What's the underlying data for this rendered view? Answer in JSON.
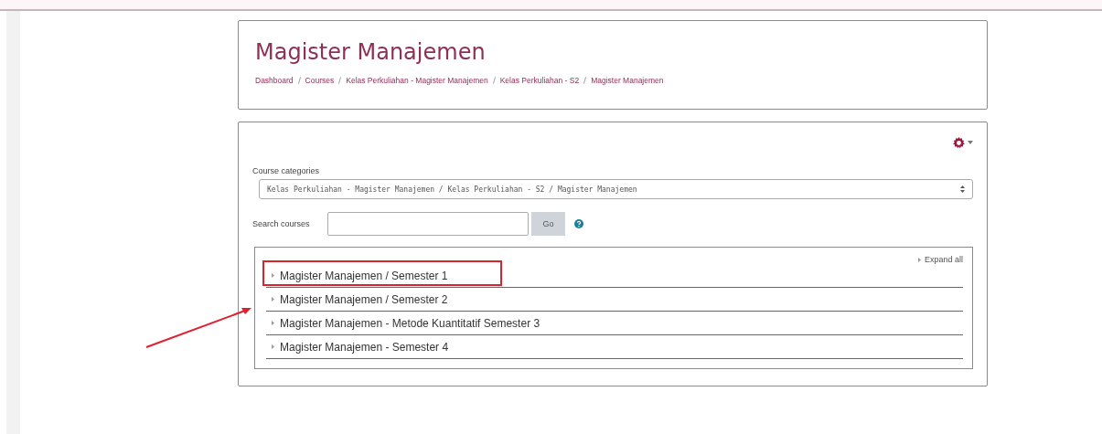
{
  "header": {
    "title": "Magister Manajemen",
    "breadcrumb": [
      "Dashboard",
      "Courses",
      "Kelas Perkuliahan - Magister Manajemen",
      "Kelas Perkuliahan - S2",
      "Magister Manajemen"
    ]
  },
  "course_categories": {
    "label": "Course categories",
    "value": "Kelas Perkuliahan - Magister Manajemen / Kelas Perkuliahan - S2 / Magister Manajemen"
  },
  "search": {
    "label": "Search courses",
    "button": "Go"
  },
  "expand_all": "Expand all",
  "categories": [
    {
      "name": "Magister Manajemen / Semester 1",
      "highlighted": true
    },
    {
      "name": "Magister Manajemen / Semester 2",
      "highlighted": false
    },
    {
      "name": "Magister Manajemen - Metode Kuantitatif Semester 3",
      "highlighted": false
    },
    {
      "name": "Magister Manajemen - Semester 4",
      "highlighted": false
    }
  ],
  "annotation": {
    "arrow": true
  }
}
